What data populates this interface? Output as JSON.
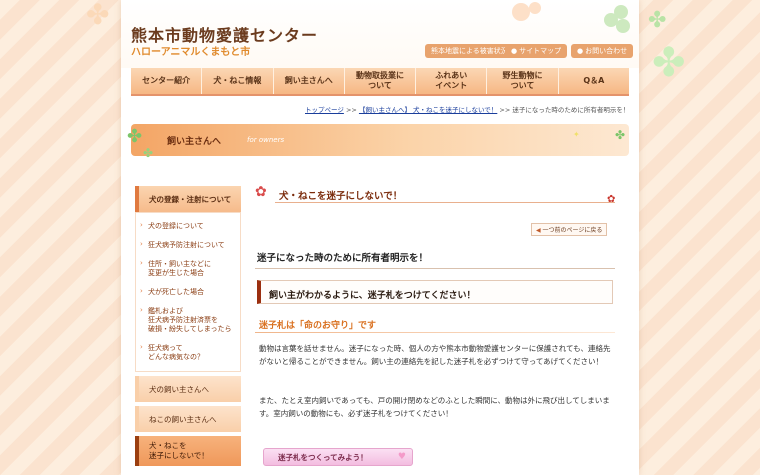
{
  "header": {
    "title": "熊本市動物愛護センター",
    "subtitle": "ハローアニマルくまもと市",
    "utility_links": [
      {
        "label": "熊本地震による被害状況",
        "icon": "none"
      },
      {
        "label": "サイトマップ",
        "icon": "circle-arrow-icon"
      },
      {
        "label": "お問い合わせ",
        "icon": "circle-arrow-icon"
      }
    ]
  },
  "nav": {
    "items": [
      "センター紹介",
      "犬・ねこ情報",
      "飼い主さんへ",
      "動物取扱業に\nついて",
      "ふれあい\nイベント",
      "野生動物に\nついて",
      "Q＆A"
    ]
  },
  "breadcrumb": {
    "home": "トップページ",
    "sep": ">>",
    "parent": "【飼い主さんへ】 犬・ねこを迷子にしないで！",
    "current": "迷子になった時のために所有者明示を！"
  },
  "banner": {
    "title": "飼い主さんへ",
    "en": "for owners"
  },
  "sidebar": {
    "section_title": "犬の登録・注射について",
    "links": [
      "犬の登録について",
      "狂犬病予防注射について",
      "住所・飼い主などに\n変更が生じた場合",
      "犬が死亡した場合",
      "鑑札および\n狂犬病予防注射済票を\n破損・紛失してしまったら",
      "狂犬病って\nどんな病気なの？"
    ],
    "categories": [
      {
        "label": "犬の飼い主さんへ",
        "active": false
      },
      {
        "label": "ねこの飼い主さんへ",
        "active": false
      },
      {
        "label": "犬・ねこを\n迷子にしないで！",
        "active": true
      }
    ]
  },
  "content": {
    "page_title": "犬・ねこを迷子にしないで！",
    "back_link": "一つ前のページに戻る",
    "section_title": "迷子になった時のために所有者明示を！",
    "box_title": "飼い主がわかるように、迷子札をつけてください！",
    "subheading": "迷子札は「命のお守り」です",
    "paragraph1": "動物は言葉を話せません。迷子になった時、個人の方や熊本市動物愛護センターに保護されても、連絡先がないと帰ることができません。飼い主の連絡先を記した迷子札を必ずつけて守ってあげてください！",
    "paragraph2": "また、たとえ室内飼いであっても、戸の開け閉めなどのふとした瞬間に、動物は外に飛び出してしまいます。室内飼いの動物にも、必ず迷子札をつけてください！",
    "make_button": "迷子札をつくってみよう！"
  },
  "colors": {
    "accent": "#e07a40",
    "nav_bg": "#f6b784",
    "title_brown": "#6b3b1e",
    "subtitle_orange": "#e08a2c"
  }
}
